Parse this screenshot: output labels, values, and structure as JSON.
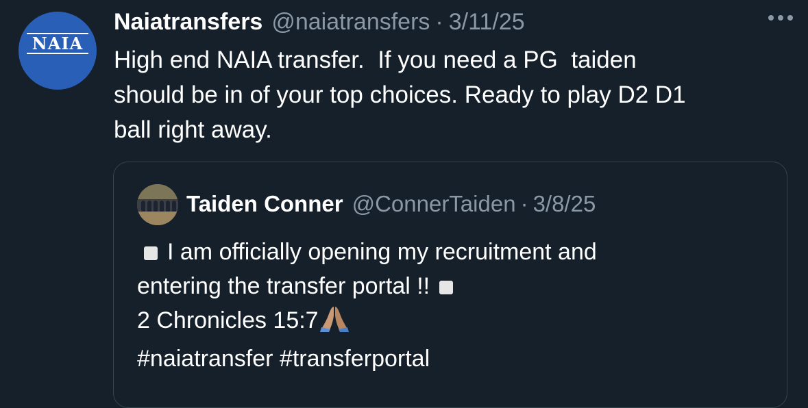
{
  "tweet": {
    "author": {
      "display_name": "Naiatransfers",
      "handle": "@naiatransfers",
      "avatar_logo_text": "NAIA"
    },
    "separator": "·",
    "date": "3/11/25",
    "text": "High end NAIA transfer.  If you need a PG  taiden\nshould be in of your top choices. Ready to play D2 D1\nball right away."
  },
  "quoted_tweet": {
    "author": {
      "display_name": "Taiden Conner",
      "handle": "@ConnerTaiden"
    },
    "separator": "·",
    "date": "3/8/25",
    "line1": "I am officially opening my recruitment and",
    "line2": "entering the transfer portal !!",
    "line3": "2 Chronicles 15:7",
    "hashtags": [
      "#naiatransfer",
      "#transferportal"
    ]
  },
  "colors": {
    "background": "#15202b",
    "secondary_text": "#8b98a5",
    "border": "#38444d",
    "naia_blue": "#2a5fb8"
  },
  "icons": {
    "more": "more-horizontal-icon",
    "emoji_square": "white-square-emoji",
    "emoji_pray": "folded-hands-emoji"
  }
}
